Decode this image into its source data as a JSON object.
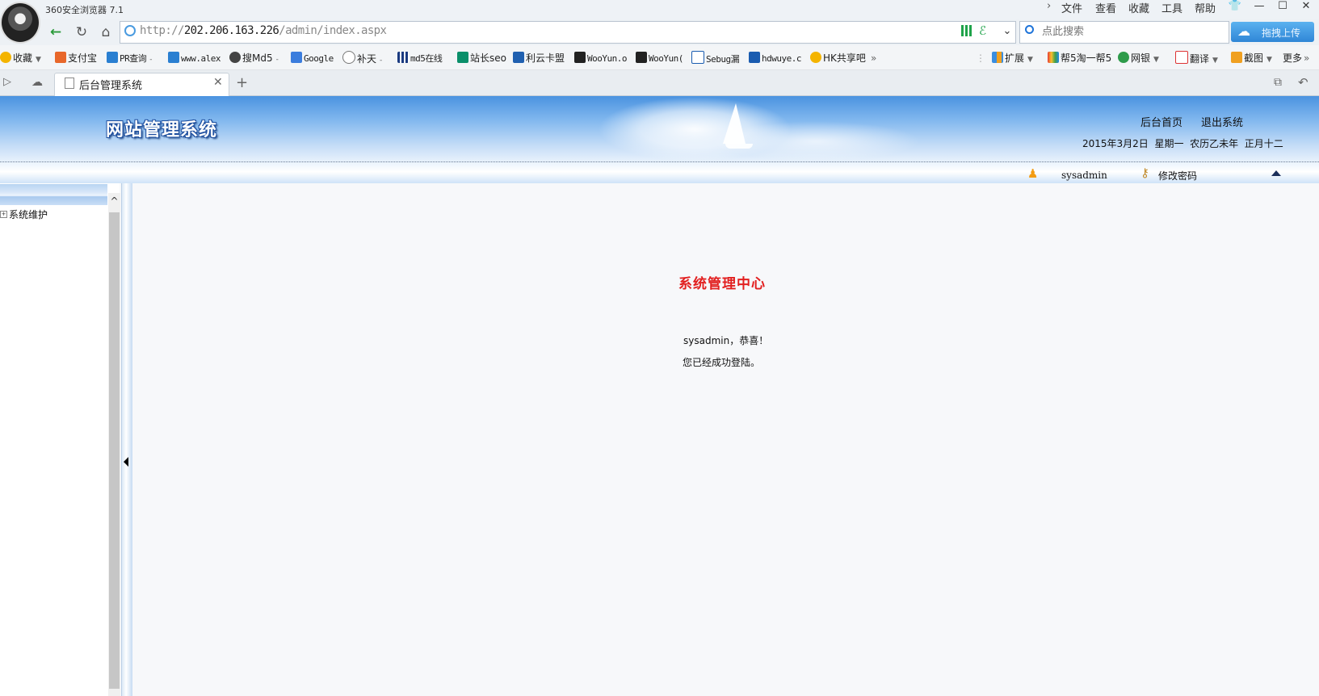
{
  "browser": {
    "title": "360安全浏览器 7.1",
    "menu": [
      "文件",
      "查看",
      "收藏",
      "工具",
      "帮助"
    ],
    "address": {
      "scheme": "http://",
      "host": "202.206.163.226",
      "path": "/admin/index.aspx"
    },
    "search_placeholder": "点此搜索",
    "upload_label": "拖拽上传",
    "bookmarks": [
      {
        "label": "收藏",
        "icon": "star-icon",
        "color": "#f4b400",
        "dropdown": true
      },
      {
        "label": "支付宝",
        "icon": "alipay-icon",
        "color": "#e8672a"
      },
      {
        "label": "PR查询",
        "icon": "pr-icon",
        "color": "#2a7fd1",
        "dropdown": true
      },
      {
        "label": "www.alex",
        "icon": "alexa-icon",
        "color": "#2a7fd1"
      },
      {
        "label": "搜Md5",
        "icon": "md5-icon",
        "color": "#444",
        "dropdown": true
      },
      {
        "label": "Google",
        "icon": "google-icon",
        "color": "#3b7ddd"
      },
      {
        "label": "补天",
        "icon": "butian-icon",
        "color": "#777",
        "dropdown": true
      },
      {
        "label": "md5在线",
        "icon": "grid-icon",
        "color": "#1a3a80"
      },
      {
        "label": "站长seo",
        "icon": "seo-icon",
        "color": "#0a8f6a"
      },
      {
        "label": "利云卡盟",
        "icon": "card-icon",
        "color": "#2060b0"
      },
      {
        "label": "WooYun.o",
        "icon": "wooyun-icon",
        "color": "#222"
      },
      {
        "label": "WooYun(",
        "icon": "wooyun-icon",
        "color": "#222"
      },
      {
        "label": "Sebug漏",
        "icon": "sebug-icon",
        "color": "#1a5cb0"
      },
      {
        "label": "hdwuye.c",
        "icon": "hdwuye-icon",
        "color": "#1a5cb0"
      },
      {
        "label": "HK共享吧",
        "icon": "hk-icon",
        "color": "#f4b400"
      }
    ],
    "toolbar_right": [
      {
        "label": "扩展",
        "icon": "extension-icon"
      },
      {
        "label": "帮5淘一帮5",
        "icon": "m-icon"
      },
      {
        "label": "网银",
        "icon": "bank-icon"
      },
      {
        "label": "翻译",
        "icon": "translate-icon"
      },
      {
        "label": "截图",
        "icon": "screenshot-icon"
      },
      {
        "label": "更多",
        "icon": "more-icon"
      }
    ],
    "tab_title": "后台管理系统"
  },
  "header": {
    "site_title": "网站管理系统",
    "links": [
      "后台首页",
      "退出系统"
    ],
    "date": "2015年3月2日  星期一  农历乙未年  正月十二",
    "username": "sysadmin",
    "change_password": "修改密码"
  },
  "sidebar": {
    "items": [
      {
        "label": "系统维护",
        "toggle": "+"
      }
    ]
  },
  "main": {
    "title": "系统管理中心",
    "greeting": "sysadmin，恭喜！",
    "message": "您已经成功登陆。"
  }
}
